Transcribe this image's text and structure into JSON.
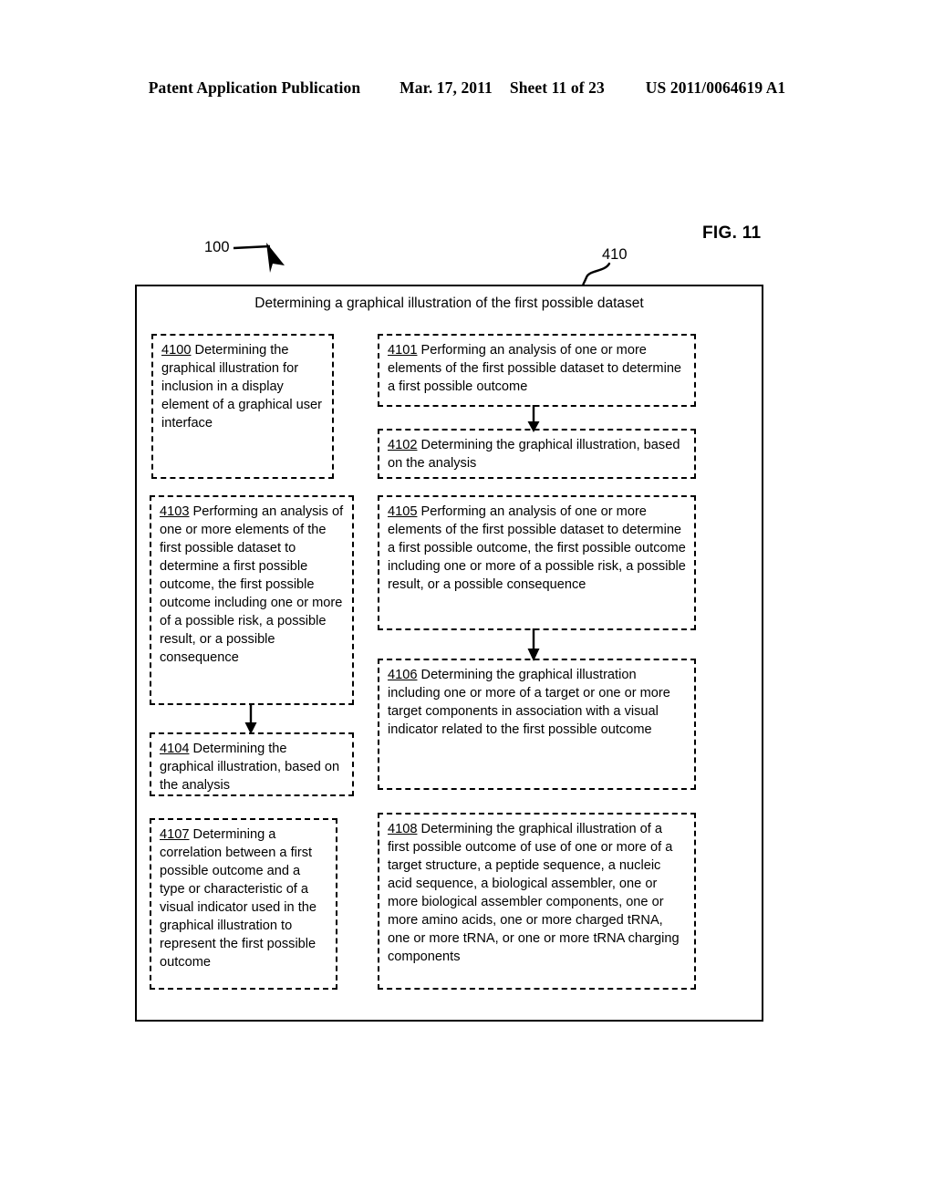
{
  "header": {
    "publication": "Patent Application Publication",
    "date": "Mar. 17, 2011",
    "sheet": "Sheet 11 of 23",
    "patent_number": "US 2011/0064619 A1"
  },
  "figure": {
    "label": "FIG. 11",
    "ref_flow": "100",
    "ref_outer_box": "410",
    "outer_box_title": "Determining a graphical illustration of the first possible dataset"
  },
  "steps": [
    {
      "id": "4100",
      "number": "4100",
      "text": " Determining the graphical illustration for inclusion in a display element of a graphical user interface"
    },
    {
      "id": "4101",
      "number": "4101",
      "text": " Performing an analysis of one or more elements of the first possible dataset to determine a first possible outcome"
    },
    {
      "id": "4102",
      "number": "4102",
      "text": " Determining the graphical illustration, based on the analysis"
    },
    {
      "id": "4103",
      "number": "4103",
      "text": " Performing an analysis of one or more elements of the first possible dataset to determine a first possible outcome, the first possible outcome including one or more of a possible risk, a possible result, or a possible consequence"
    },
    {
      "id": "4104",
      "number": "4104",
      "text": " Determining the graphical illustration, based on the analysis"
    },
    {
      "id": "4105",
      "number": "4105",
      "text": " Performing an analysis of one or more elements of the first possible dataset to determine a first possible outcome, the first possible outcome including one or more of a possible risk, a possible result, or a possible consequence"
    },
    {
      "id": "4106",
      "number": "4106",
      "text": " Determining the graphical illustration including one or more of a target or one or more target components in association with a visual indicator related to the first possible outcome"
    },
    {
      "id": "4107",
      "number": "4107",
      "text": " Determining a correlation between a first possible outcome and a type or characteristic of a visual indicator used in the graphical illustration to represent the first possible outcome"
    },
    {
      "id": "4108",
      "number": "4108",
      "text": " Determining the graphical illustration of a first possible outcome of use of one or more of a target structure, a peptide sequence, a nucleic acid sequence, a biological assembler, one or more biological assembler components, one or more amino acids, one or more charged tRNA, one or more tRNA, or one or more tRNA charging components"
    }
  ],
  "connectors": [
    {
      "from": "4101",
      "to": "4102"
    },
    {
      "from": "4103",
      "to": "4104"
    },
    {
      "from": "4105",
      "to": "4106"
    }
  ],
  "colors": {
    "ink": "#000000",
    "paper": "#ffffff"
  }
}
